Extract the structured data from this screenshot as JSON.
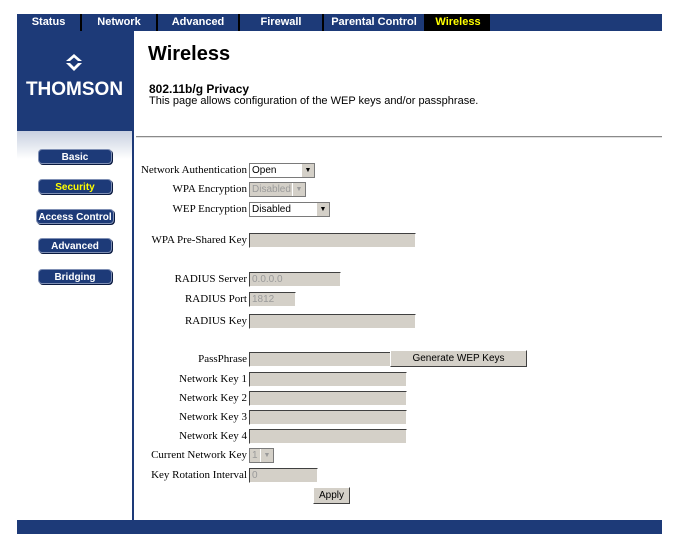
{
  "nav": {
    "tabs": [
      "Status",
      "Network",
      "Advanced",
      "Firewall",
      "Parental Control",
      "Wireless"
    ],
    "selected": "Wireless"
  },
  "sidebar": {
    "logo_text": "THOMSON",
    "buttons": [
      "Basic",
      "Security",
      "Access Control",
      "Advanced",
      "Bridging"
    ],
    "selected": "Security"
  },
  "page": {
    "title": "Wireless",
    "subtitle": "802.11b/g Privacy",
    "description": "This page allows configuration of the WEP keys and/or passphrase."
  },
  "form": {
    "network_auth_label": "Network Authentication",
    "network_auth_value": "Open",
    "wpa_encryption_label": "WPA Encryption",
    "wpa_encryption_value": "Disabled",
    "wep_encryption_label": "WEP Encryption",
    "wep_encryption_value": "Disabled",
    "wpa_psk_label": "WPA Pre-Shared Key",
    "wpa_psk_value": "",
    "radius_server_label": "RADIUS Server",
    "radius_server_value": "0.0.0.0",
    "radius_port_label": "RADIUS Port",
    "radius_port_value": "1812",
    "radius_key_label": "RADIUS Key",
    "radius_key_value": "",
    "passphrase_label": "PassPhrase",
    "passphrase_value": "",
    "generate_button": "Generate WEP Keys",
    "network_key_1_label": "Network Key 1",
    "network_key_2_label": "Network Key 2",
    "network_key_3_label": "Network Key 3",
    "network_key_4_label": "Network Key 4",
    "current_key_label": "Current Network Key",
    "current_key_value": "1",
    "key_rotation_label": "Key Rotation Interval",
    "key_rotation_value": "0",
    "apply_button": "Apply"
  },
  "colors": {
    "brand_blue": "#1d3a78",
    "selected_text": "#ffff00"
  }
}
